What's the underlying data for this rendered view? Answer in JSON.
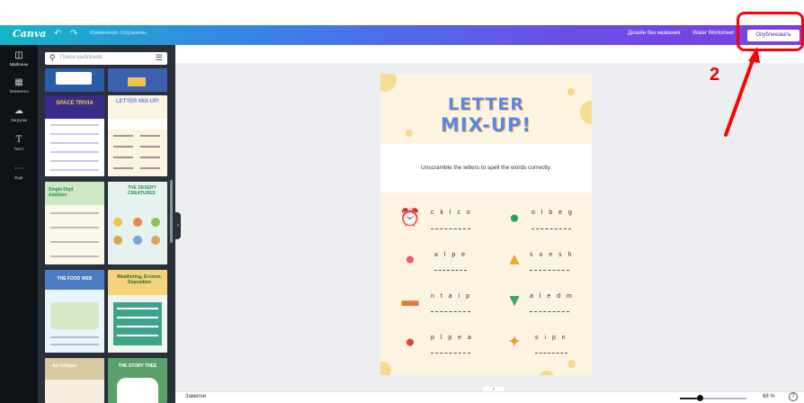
{
  "topbar": {
    "logo": "Canva",
    "undo_icon": "undo-icon",
    "redo_icon": "redo-icon",
    "saved_status": "Изменения сохранены",
    "doc_title": "Дизайн без названия",
    "doc_subtitle": "Water Worksheet",
    "publish_label": "Опубликовать",
    "gradient_colors": [
      "#13b5c7",
      "#3d7ee8",
      "#6a4ee6",
      "#7b3fe4"
    ]
  },
  "sidenav": {
    "items": [
      {
        "icon": "templates-icon",
        "label": "Шаблоны"
      },
      {
        "icon": "elements-icon",
        "label": "Элементы"
      },
      {
        "icon": "upload-icon",
        "label": "Загрузки"
      },
      {
        "icon": "text-icon",
        "label": "Текст"
      },
      {
        "icon": "more-icon",
        "label": "Ещё"
      }
    ]
  },
  "panel": {
    "search_placeholder": "Поиск шаблонов",
    "search_icon": "search-icon",
    "filter_icon": "filter-icon",
    "thumbnails": [
      {
        "title": ""
      },
      {
        "title": ""
      },
      {
        "title": "SPACE TRIVIA"
      },
      {
        "title": "LETTER MIX-UP!"
      },
      {
        "title": "Single Digit Addition"
      },
      {
        "title": "THE DESERT CREATURES"
      },
      {
        "title": "THE FOOD WEB"
      },
      {
        "title": "Weathering, Erosion, Deposition"
      },
      {
        "title": "Art Critique"
      },
      {
        "title": "THE STORY TREE"
      }
    ]
  },
  "worksheet": {
    "title_line1": "LETTER",
    "title_line2": "MIX-UP!",
    "instruction": "Unscramble the letters to spell the words correctly.",
    "items": [
      {
        "letters": "c k l c o",
        "icon": "alarm-clock-icon",
        "blank": "_ _ _ _ _"
      },
      {
        "letters": "o l b e g",
        "icon": "globe-icon",
        "blank": "_ _ _ _ _"
      },
      {
        "letters": "a l p e",
        "icon": "apple-icon",
        "blank": "_ _ _ _"
      },
      {
        "letters": "s o e s h",
        "icon": "shoe-icon",
        "blank": "_ _ _ _ _"
      },
      {
        "letters": "n t a i p",
        "icon": "paint-icon",
        "blank": "_ _ _ _ _"
      },
      {
        "letters": "a l e d m",
        "icon": "medal-icon",
        "blank": "_ _ _ _ _"
      },
      {
        "letters": "p l p e a",
        "icon": "apple-icon",
        "blank": "_ _ _ _ _"
      },
      {
        "letters": "s i p n",
        "icon": "pins-icon",
        "blank": "_ _ _ _"
      }
    ],
    "title_color": "#5b86e8",
    "page_color": "#fdf3e1"
  },
  "bottombar": {
    "notes_label": "Заметки",
    "zoom": "68 %",
    "zoom_fraction": 0.3,
    "help_icon": "help-icon"
  },
  "annotation": {
    "step_number": "2"
  }
}
